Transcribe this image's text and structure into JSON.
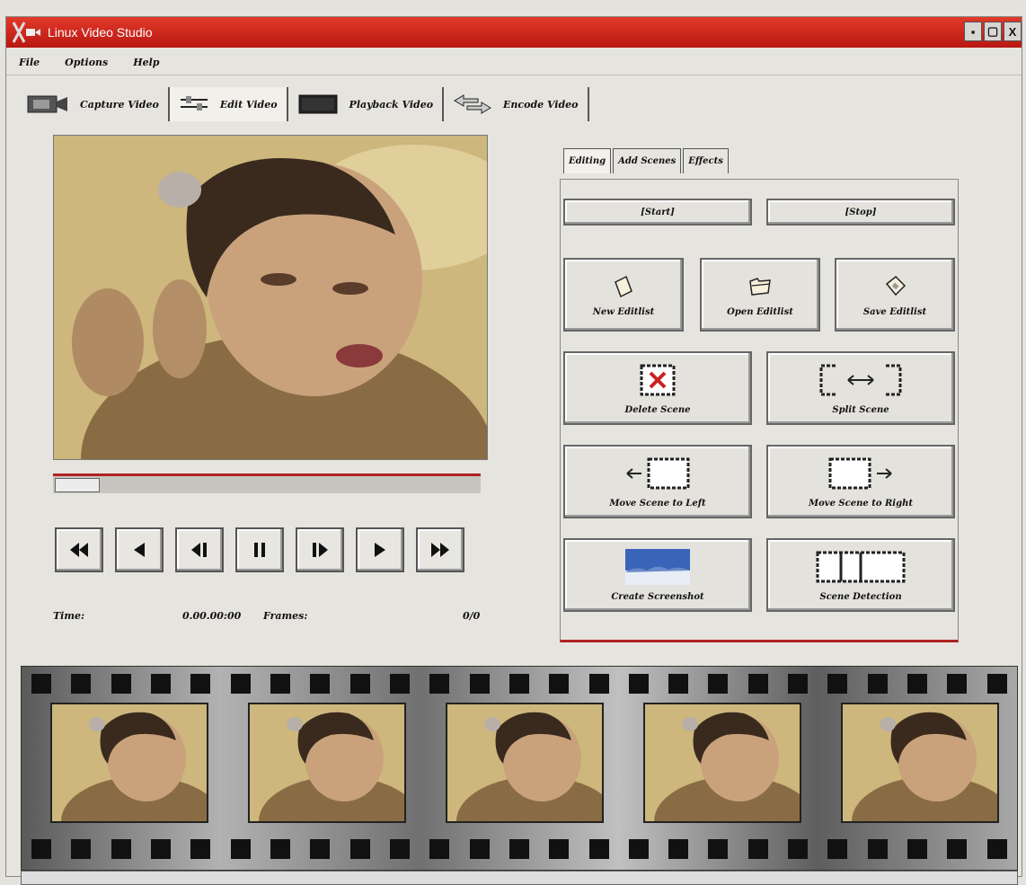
{
  "window": {
    "title": "Linux Video Studio"
  },
  "menu": [
    "File",
    "Options",
    "Help"
  ],
  "modes": [
    {
      "label": "Capture Video",
      "icon": "camera-icon"
    },
    {
      "label": "Edit Video",
      "icon": "edit-sliders-icon"
    },
    {
      "label": "Playback Video",
      "icon": "monitor-icon"
    },
    {
      "label": "Encode Video",
      "icon": "arrows-icon"
    }
  ],
  "tabs": [
    "Editing",
    "Add Scenes",
    "Effects"
  ],
  "buttons": {
    "start": "[Start]",
    "stop": "[Stop]",
    "new_editlist": "New Editlist",
    "open_editlist": "Open Editlist",
    "save_editlist": "Save Editlist",
    "delete_scene": "Delete Scene",
    "split_scene": "Split Scene",
    "move_left": "Move Scene to Left",
    "move_right": "Move Scene to Right",
    "create_screenshot": "Create Screenshot",
    "scene_detection": "Scene Detection"
  },
  "time": {
    "time_label": "Time:",
    "time_value": "0.00.00:00",
    "frames_label": "Frames:",
    "frames_value": "0/0"
  },
  "playback": {
    "position": 0.0
  },
  "filmstrip": {
    "frame_count": 5
  },
  "colors": {
    "titlebar": "#c8201a",
    "accent": "#b02222",
    "panel": "#e6e4de"
  }
}
